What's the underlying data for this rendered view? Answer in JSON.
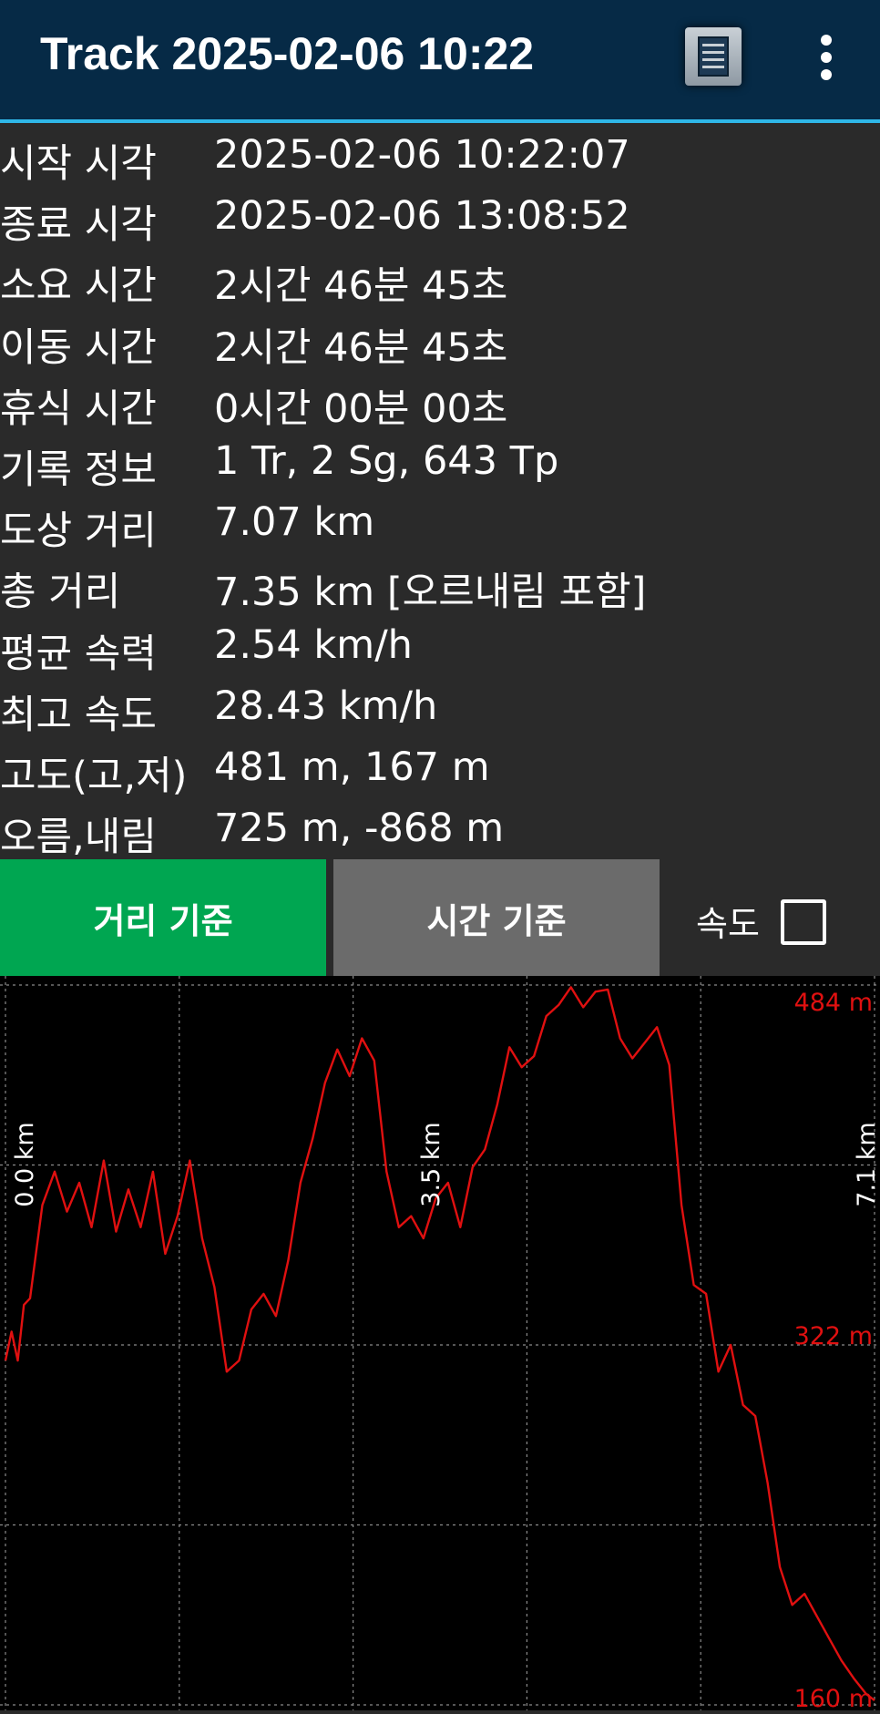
{
  "appbar": {
    "title": "Track 2025-02-06 10:22",
    "list_icon": "list-icon",
    "more_icon": "more-vert-icon"
  },
  "info_rows": [
    {
      "label": "시작 시각",
      "value": "2025-02-06 10:22:07"
    },
    {
      "label": "종료 시각",
      "value": "2025-02-06 13:08:52"
    },
    {
      "label": "소요 시간",
      "value": "2시간 46분 45초"
    },
    {
      "label": "이동 시간",
      "value": "2시간 46분 45초"
    },
    {
      "label": "휴식 시간",
      "value": "0시간 00분 00초"
    },
    {
      "label": "기록 정보",
      "value": "1 Tr, 2 Sg, 643 Tp"
    },
    {
      "label": "도상 거리",
      "value": "7.07 km"
    },
    {
      "label": "총 거리",
      "value": "7.35 km [오르내림 포함]"
    },
    {
      "label": "평균 속력",
      "value": "2.54 km/h"
    },
    {
      "label": "최고 속도",
      "value": "28.43 km/h"
    },
    {
      "label": "고도(고,저)",
      "value": "481 m, 167 m"
    },
    {
      "label": "오름,내림",
      "value": "725 m, -868 m"
    }
  ],
  "mode": {
    "distance_label": "거리 기준",
    "time_label": "시간 기준",
    "speed_label": "속도",
    "speed_checked": false,
    "active": "distance"
  },
  "colors": {
    "appbar_bg": "#062a46",
    "accent_line": "#2fb7e8",
    "active_button": "#00a651",
    "inactive_button": "#6b6b6b",
    "series": "#e01010"
  },
  "chart_data": {
    "type": "line",
    "xlabel": "",
    "ylabel": "",
    "x_tick_labels": [
      "0.0 km",
      "3.5 km",
      "7.1 km"
    ],
    "y_tick_labels": [
      "484 m",
      "322 m",
      "160 m"
    ],
    "xlim": [
      0,
      7.07
    ],
    "ylim": [
      160,
      484
    ],
    "grid": true,
    "series": [
      {
        "x": [
          0.0,
          0.05,
          0.1,
          0.15,
          0.2,
          0.3,
          0.4,
          0.5,
          0.6,
          0.7,
          0.8,
          0.9,
          1.0,
          1.1,
          1.2,
          1.3,
          1.4,
          1.5,
          1.6,
          1.7,
          1.8,
          1.9,
          2.0,
          2.1,
          2.2,
          2.3,
          2.4,
          2.5,
          2.6,
          2.7,
          2.8,
          2.9,
          3.0,
          3.1,
          3.2,
          3.3,
          3.4,
          3.5,
          3.6,
          3.7,
          3.8,
          3.9,
          4.0,
          4.1,
          4.2,
          4.3,
          4.4,
          4.5,
          4.6,
          4.7,
          4.8,
          4.9,
          5.0,
          5.1,
          5.2,
          5.3,
          5.4,
          5.5,
          5.6,
          5.7,
          5.8,
          5.9,
          6.0,
          6.1,
          6.2,
          6.3,
          6.4,
          6.5,
          6.6,
          6.7,
          6.8,
          6.9,
          7.0,
          7.07
        ],
        "y": [
          315,
          328,
          315,
          340,
          343,
          385,
          400,
          382,
          395,
          375,
          405,
          373,
          392,
          375,
          400,
          363,
          380,
          405,
          370,
          348,
          310,
          315,
          338,
          345,
          335,
          360,
          395,
          415,
          440,
          455,
          443,
          460,
          450,
          400,
          375,
          380,
          370,
          388,
          395,
          375,
          402,
          410,
          430,
          456,
          447,
          452,
          470,
          475,
          483,
          474,
          481,
          482,
          460,
          451,
          458,
          465,
          448,
          385,
          349,
          345,
          310,
          322,
          295,
          290,
          260,
          222,
          205,
          210,
          200,
          190,
          180,
          172,
          165,
          162
        ]
      }
    ]
  }
}
